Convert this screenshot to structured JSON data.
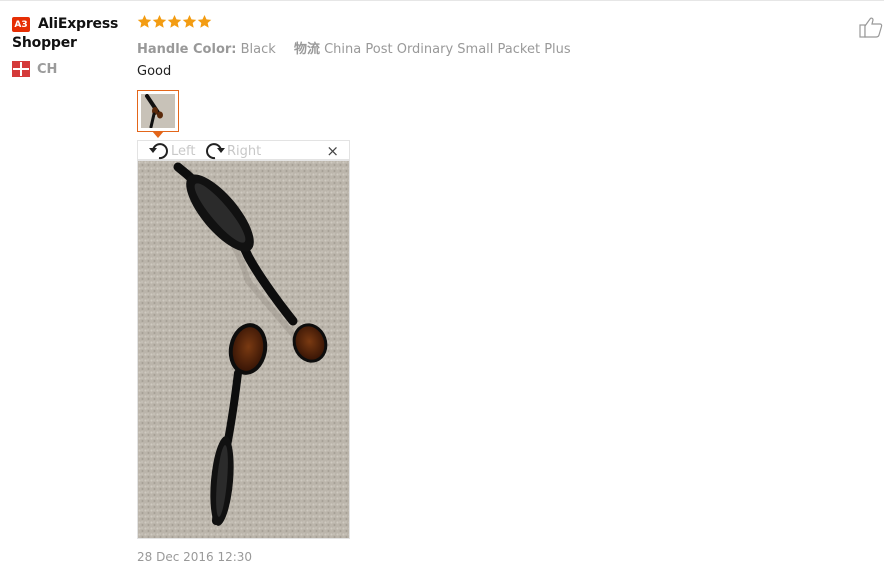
{
  "review": {
    "user": {
      "level_badge": "A3",
      "name": "AliExpress Shopper",
      "country": "CH"
    },
    "rating": 5,
    "attributes": {
      "color_key": "Handle Color:",
      "color_value": "Black",
      "shipping_label": "物流",
      "shipping_value": "China Post Ordinary Small Packet Plus"
    },
    "text": "Good",
    "viewer": {
      "rotate_left": "Left",
      "rotate_right": "Right",
      "close": "×"
    },
    "date": "28 Dec 2016 12:30"
  },
  "colors": {
    "star": "#f39c12",
    "badge": "#e62e04",
    "thumb_border": "#e3661a",
    "flag": "#d43a3a"
  },
  "icons": [
    "star-icon",
    "thumbs-up-icon",
    "rotate-left-icon",
    "rotate-right-icon",
    "close-icon",
    "swiss-flag-icon"
  ]
}
